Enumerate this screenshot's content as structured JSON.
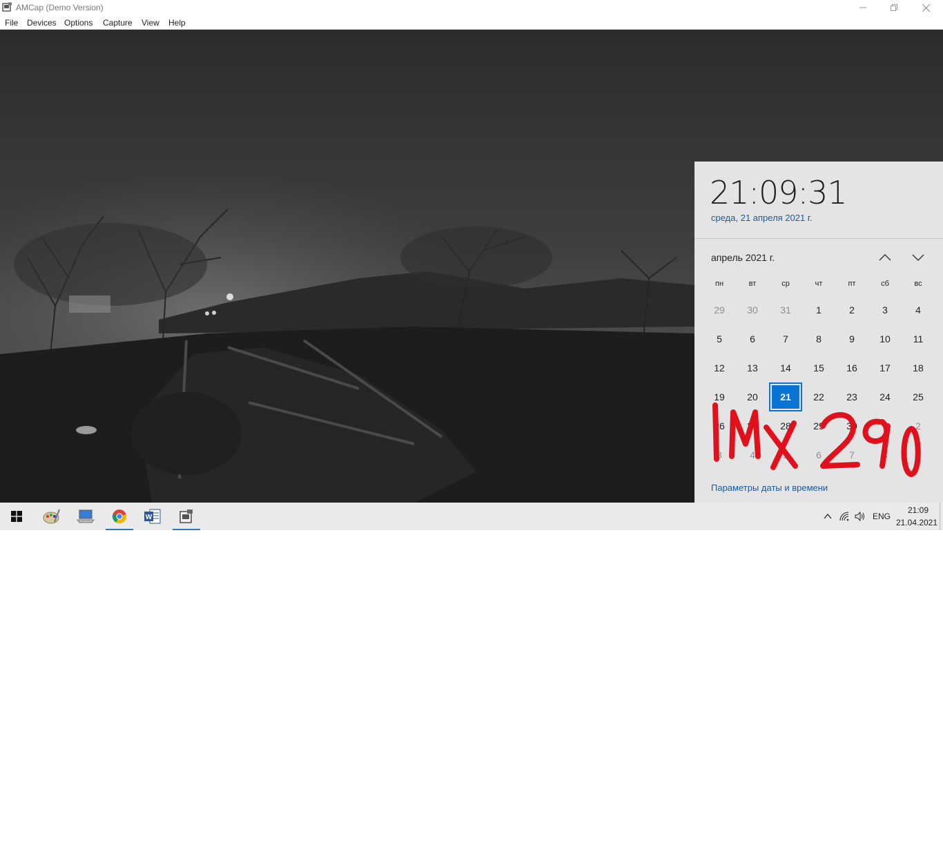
{
  "window": {
    "title": "AMCap (Demo Version)"
  },
  "menu": [
    "File",
    "Devices",
    "Options",
    "Capture",
    "View",
    "Help"
  ],
  "flyout": {
    "time": "21:09:31",
    "date": "среда, 21 апреля 2021 г.",
    "month_label": "апрель 2021 г.",
    "weekdays": [
      "пн",
      "вт",
      "ср",
      "чт",
      "пт",
      "сб",
      "вс"
    ],
    "weeks": [
      [
        "29",
        "30",
        "31",
        "1",
        "2",
        "3",
        "4"
      ],
      [
        "5",
        "6",
        "7",
        "8",
        "9",
        "10",
        "11"
      ],
      [
        "12",
        "13",
        "14",
        "15",
        "16",
        "17",
        "18"
      ],
      [
        "19",
        "20",
        "21",
        "22",
        "23",
        "24",
        "25"
      ],
      [
        "26",
        "27",
        "28",
        "29",
        "30",
        "1",
        "2"
      ],
      [
        "3",
        "4",
        "5",
        "6",
        "7",
        "8",
        "9"
      ]
    ],
    "today": "21",
    "settings_link": "Параметры даты и времени",
    "handwritten_annotation": "IMX 290"
  },
  "taskbar": {
    "apps": [
      "start-icon",
      "paint-icon",
      "laptop-icon",
      "chrome-icon",
      "word-icon",
      "amcap-icon"
    ],
    "language": "ENG",
    "clock_time": "21:09",
    "clock_date": "21.04.2021"
  },
  "colors": {
    "accent": "#0a74d6",
    "link": "#1a5a9e",
    "annotation": "#e0101c"
  }
}
